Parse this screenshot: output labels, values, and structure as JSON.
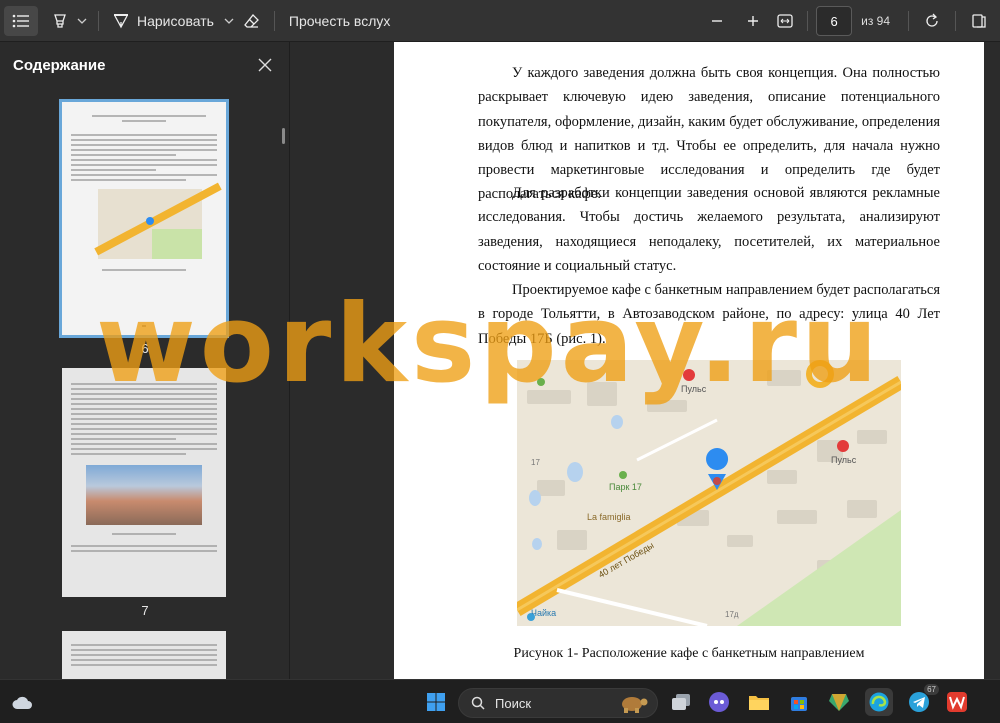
{
  "toolbar": {
    "draw_label": "Нарисовать",
    "read_aloud_label": "Прочесть вслух",
    "page_current": "6",
    "page_total": "из 94"
  },
  "sidebar": {
    "title": "Содержание",
    "pages": [
      "6",
      "7"
    ]
  },
  "document": {
    "paragraphs": [
      "У каждого заведения должна быть своя концепция. Она полностью раскрывает ключевую идею заведения, описание потенциального покупателя, оформление, дизайн, каким будет обслуживание, определения видов блюд и напитков и тд. Чтобы ее определить, для начала нужно провести маркетинговые исследования и определить где будет располагаться кафе.",
      "Для разработки концепции заведения основой являются рекламные исследования. Чтобы достичь желаемого результата, анализируют заведения, находящиеся неподалеку, посетителей, их материальное состояние и социальный статус.",
      "Проектируемое кафе с банкетным направлением будет располагаться в городе Тольятти, в Автозаводском районе, по адресу: улица 40 Лет Победы 17Б (рис. 1)."
    ],
    "map_labels": {
      "street": "40 лет Победы",
      "pulse_top": "Пульс",
      "pulse_right": "Пульс",
      "park": "Парк 17",
      "restaurant": "La famiglia",
      "stop": "Чайка",
      "num17": "17",
      "num17d": "17д"
    },
    "caption": "Рисунок 1- Расположение кафе с банкетным направлением"
  },
  "taskbar": {
    "search_label": "Поиск",
    "telegram_badge": "67"
  },
  "watermark": "workspay.ru",
  "colors": {
    "accent": "#69a7d9",
    "watermark": "#ef9f14",
    "road": "#f2b430",
    "pin": "#2d8cf0"
  }
}
